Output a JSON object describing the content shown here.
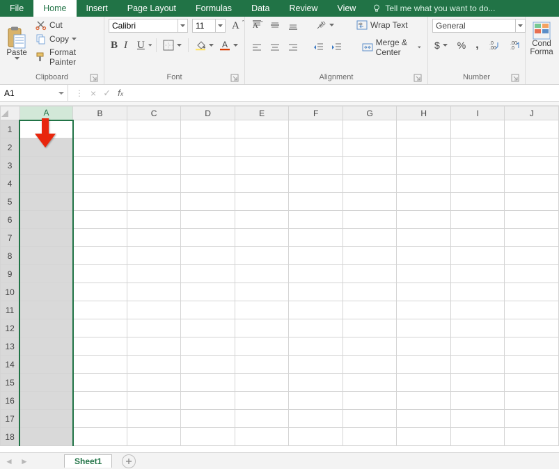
{
  "tabs": [
    "File",
    "Home",
    "Insert",
    "Page Layout",
    "Formulas",
    "Data",
    "Review",
    "View"
  ],
  "active_tab": "Home",
  "tellme_placeholder": "Tell me what you want to do...",
  "clipboard": {
    "paste": "Paste",
    "cut": "Cut",
    "copy": "Copy",
    "format_painter": "Format Painter",
    "label": "Clipboard"
  },
  "font": {
    "name": "Calibri",
    "size": "11",
    "label": "Font"
  },
  "alignment": {
    "wrap": "Wrap Text",
    "merge": "Merge & Center",
    "label": "Alignment"
  },
  "number": {
    "format": "General",
    "label": "Number"
  },
  "styles": {
    "cond": "Cond",
    "format": "Forma"
  },
  "namebox": "A1",
  "formula": "",
  "columns": [
    "A",
    "B",
    "C",
    "D",
    "E",
    "F",
    "G",
    "H",
    "I",
    "J"
  ],
  "rows": [
    1,
    2,
    3,
    4,
    5,
    6,
    7,
    8,
    9,
    10,
    11,
    12,
    13,
    14,
    15,
    16,
    17,
    18
  ],
  "selected_column": "A",
  "sheet": "Sheet1"
}
